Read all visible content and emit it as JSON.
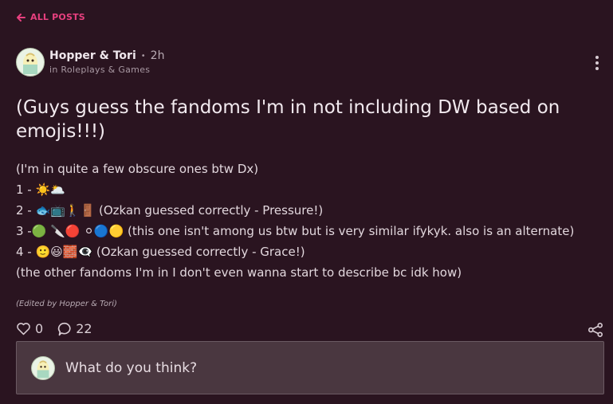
{
  "nav": {
    "back_label": "ALL POSTS"
  },
  "post": {
    "author": "Hopper & Tori",
    "time": "2h",
    "community": "in Roleplays & Games",
    "title": "(Guys guess the fandoms I'm in not including DW based on emojis!!!)",
    "body_lines": [
      "(I'm in quite a few obscure ones btw Dx)",
      "1 - ☀️🌥️",
      "2 - 🐟📺🚶🚪 (Ozkan guessed correctly - Pressure!)",
      "3 -🟢  🔪🔴 ⚪🔵🟡 (this one isn't among us btw but is very similar ifykyk. also is an alternate)",
      "4 - 🙂😃🧱👁️‍🗨️ (Ozkan guessed correctly - Grace!)",
      "(the other fandoms I'm in I don't even wanna start to describe bc idk how)"
    ],
    "edited_note": "(Edited by Hopper & Tori)",
    "likes": "0",
    "comments": "22"
  },
  "comment_box": {
    "placeholder": "What do you think?"
  },
  "colors": {
    "background": "#2a1420",
    "accent": "#e8407f",
    "input_bg": "#4a3740"
  },
  "icons": {
    "back": "arrow-left-icon",
    "more": "more-vertical-icon",
    "like": "heart-icon",
    "comment": "comment-bubble-icon",
    "share": "share-icon"
  }
}
